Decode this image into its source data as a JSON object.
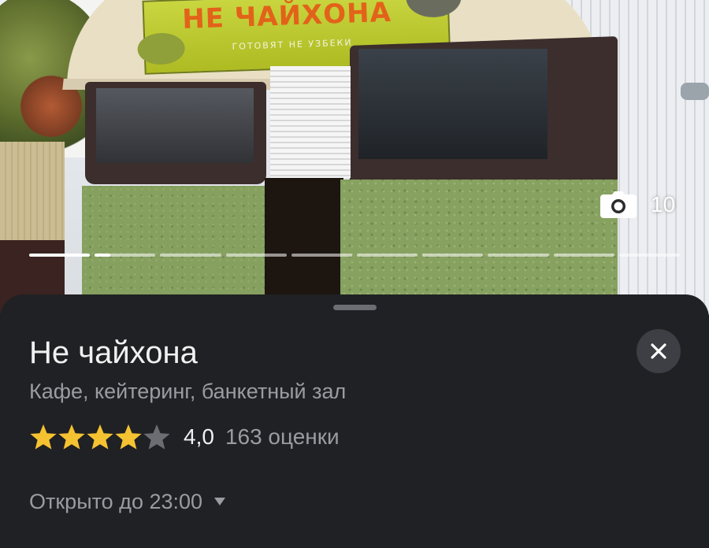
{
  "photo": {
    "sign_title": "НЕ ЧАЙХОНА",
    "sign_subtitle": "ГОТОВЯТ НЕ УЗБЕКИ",
    "photo_count": "10",
    "segments": 10,
    "current_index": 1,
    "current_fill": 1.0,
    "next_fill": 0.25
  },
  "place": {
    "name": "Не чайхона",
    "category": "Кафе, кейтеринг, банкетный зал",
    "rating": "4,0",
    "rating_value": 4.0,
    "rating_max": 5,
    "rating_count": "163 оценки",
    "hours": "Открыто до 23:00"
  },
  "icons": {
    "photo": "camera-icon",
    "close": "close-icon",
    "star": "star-icon",
    "hours": "caret-down-icon"
  },
  "colors": {
    "star_filled": "#f5c331",
    "star_empty": "#6b6d72",
    "sheet_bg": "#202124",
    "title_text": "#f1f1f2",
    "secondary_text": "#9a9ca1"
  }
}
